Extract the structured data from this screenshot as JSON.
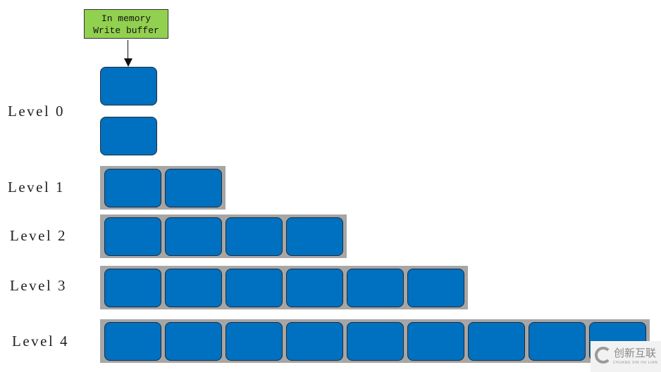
{
  "buffer": {
    "line1": "In memory",
    "line2": "Write buffer",
    "color": "#92d050"
  },
  "levels": [
    {
      "label": "Level 0",
      "sstables": 2,
      "layout": "vertical"
    },
    {
      "label": "Level 1",
      "sstables": 2
    },
    {
      "label": "Level 2",
      "sstables": 4
    },
    {
      "label": "Level 3",
      "sstables": 6
    },
    {
      "label": "Level 4",
      "sstables": 9
    }
  ],
  "colors": {
    "sstable": "#0070c0",
    "tray": "#a6a6a6"
  },
  "watermark": {
    "cn": "创新互联",
    "en": "CHUANG XIN HU LIAN"
  }
}
